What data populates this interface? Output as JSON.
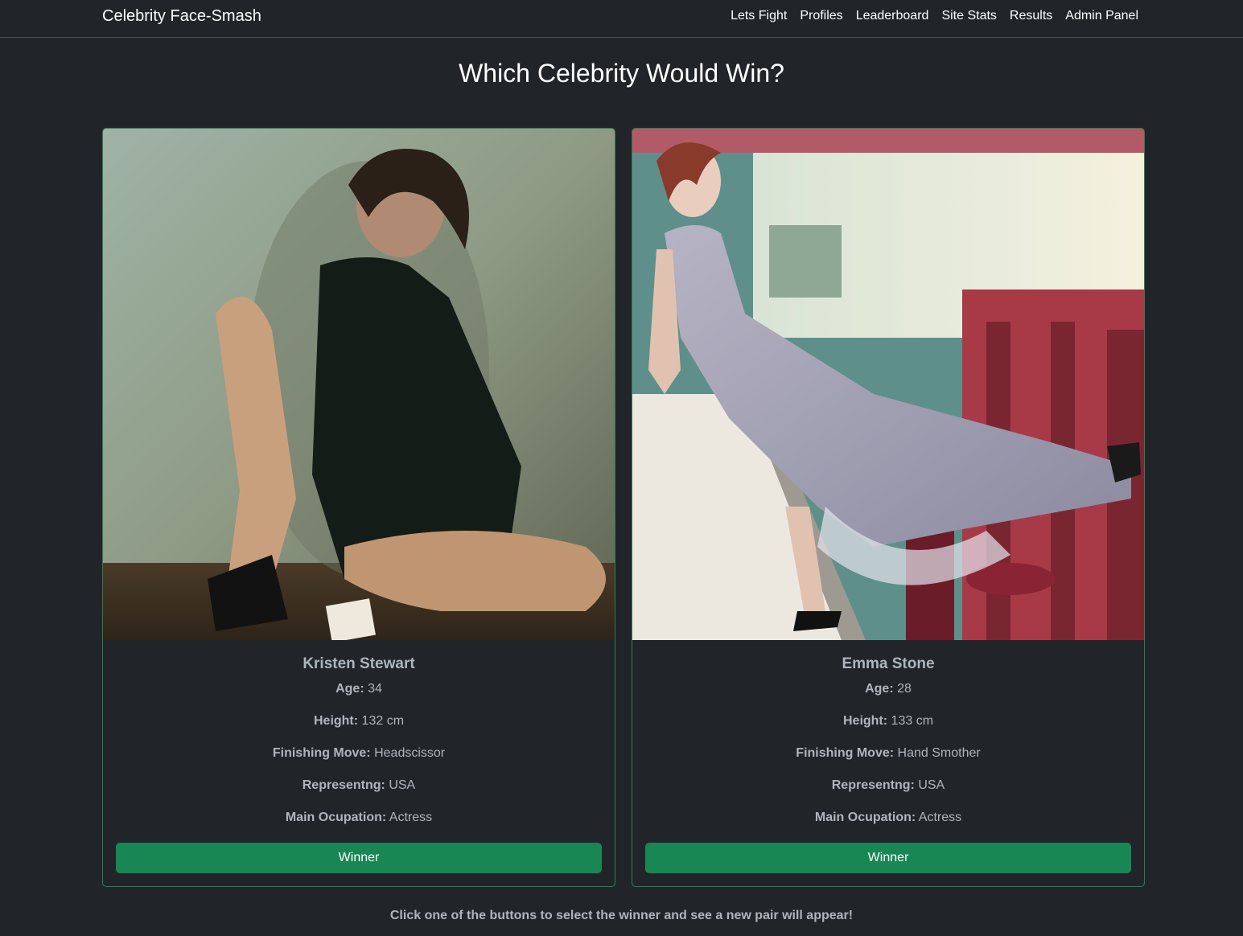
{
  "navbar": {
    "brand": "Celebrity Face-Smash",
    "links": [
      "Lets Fight",
      "Profiles",
      "Leaderboard",
      "Site Stats",
      "Results",
      "Admin Panel"
    ]
  },
  "page": {
    "title": "Which Celebrity Would Win?",
    "hint": "Click one of the buttons to select the winner and see a new pair will appear!"
  },
  "labels": {
    "age": "Age:",
    "height": "Height:",
    "finishing_move": "Finishing Move:",
    "representing": "Representng:",
    "occupation": "Main Ocupation:",
    "winner_button": "Winner"
  },
  "contenders": [
    {
      "name": "Kristen Stewart",
      "age": "34",
      "height": "132 cm",
      "finishing_move": "Headscissor",
      "representing": "USA",
      "occupation": "Actress",
      "photo_icon": "portrait-photo"
    },
    {
      "name": "Emma Stone",
      "age": "28",
      "height": "133 cm",
      "finishing_move": "Hand Smother",
      "representing": "USA",
      "occupation": "Actress",
      "photo_icon": "portrait-photo"
    }
  ],
  "colors": {
    "background": "#212529",
    "card_border": "#2e7d52",
    "button": "#198754",
    "muted_text": "#adb5bd"
  }
}
